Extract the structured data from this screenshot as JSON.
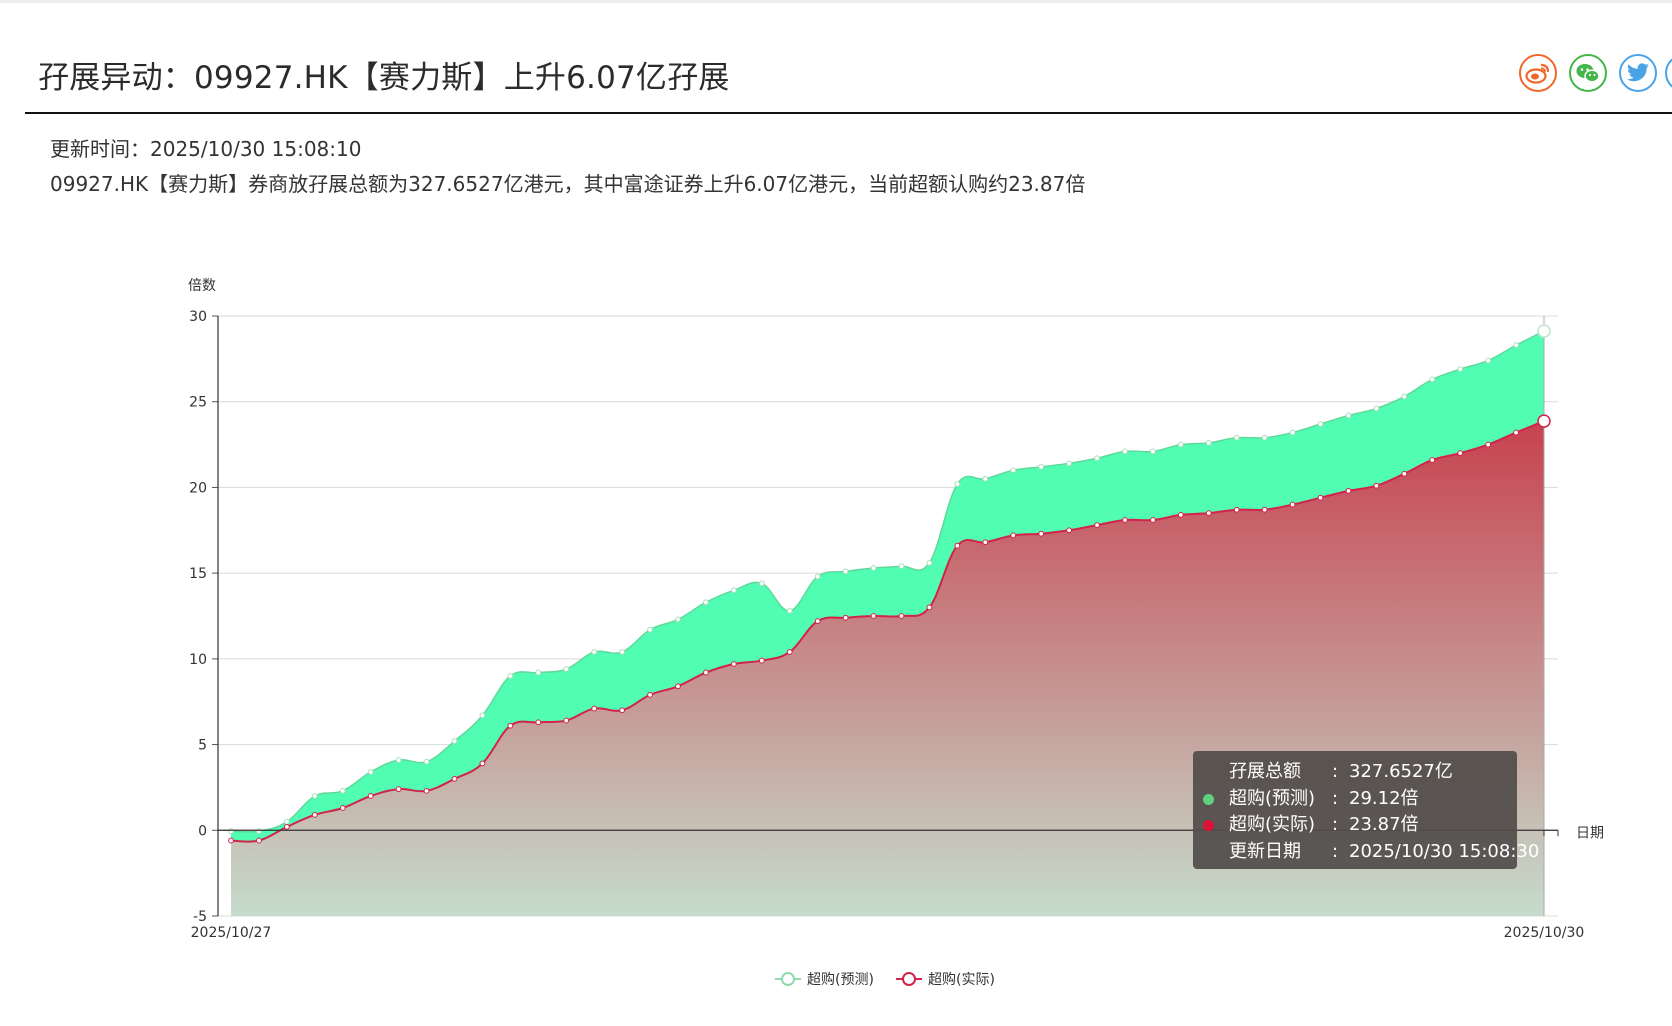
{
  "page": {
    "title": "孖展异动：09927.HK【赛力斯】上升6.07亿孖展",
    "update_time": "更新时间：2025/10/30 15:08:10",
    "summary": "09927.HK【赛力斯】券商放孖展总额为327.6527亿港元，其中富途证券上升6.07亿港元，当前超额认购约23.87倍"
  },
  "share": [
    {
      "name": "weibo-icon",
      "color": "#f0662b"
    },
    {
      "name": "wechat-icon",
      "color": "#44b549"
    },
    {
      "name": "twitter-icon",
      "color": "#4ba3e7"
    }
  ],
  "tooltip": {
    "rows": [
      {
        "label": "孖展总额",
        "value": "327.6527亿",
        "dot": ""
      },
      {
        "label": "超购(预测)",
        "value": "29.12倍",
        "dot": "#5fd17c"
      },
      {
        "label": "超购(实际)",
        "value": "23.87倍",
        "dot": "#dd1237"
      },
      {
        "label": "更新日期",
        "value": "2025/10/30 15:08:30",
        "dot": ""
      }
    ]
  },
  "chart_data": {
    "type": "area",
    "ylabel": "倍数",
    "xlabel": "日期",
    "ylim": [
      -5,
      30
    ],
    "yticks": [
      -5,
      0,
      5,
      10,
      15,
      20,
      25,
      30
    ],
    "x_tick_labels": [
      "2025/10/27",
      "2025/10/30"
    ],
    "grid": true,
    "legend_position": "bottom-center",
    "series": [
      {
        "name": "超购(预测)",
        "color": "#5fd99a",
        "fill": "#4cfdb1",
        "values": [
          -0.05,
          -0.05,
          0.5,
          2.0,
          2.3,
          3.4,
          4.1,
          4.0,
          5.2,
          6.7,
          9.0,
          9.2,
          9.4,
          10.4,
          10.4,
          11.7,
          12.3,
          13.3,
          14.0,
          14.4,
          12.8,
          14.8,
          15.1,
          15.3,
          15.4,
          15.6,
          20.2,
          20.5,
          21.0,
          21.2,
          21.4,
          21.7,
          22.1,
          22.1,
          22.5,
          22.6,
          22.9,
          22.9,
          23.2,
          23.7,
          24.2,
          24.6,
          25.3,
          26.3,
          26.9,
          27.4,
          28.3,
          29.12
        ]
      },
      {
        "name": "超购(实际)",
        "color": "#d2234a",
        "fill_top": "#c7424f",
        "fill_bottom": "#c6dccc",
        "values": [
          -0.6,
          -0.6,
          0.2,
          0.9,
          1.3,
          2.0,
          2.4,
          2.3,
          3.0,
          3.9,
          6.1,
          6.3,
          6.4,
          7.1,
          7.0,
          7.9,
          8.4,
          9.2,
          9.7,
          9.9,
          10.4,
          12.2,
          12.4,
          12.5,
          12.5,
          13.0,
          16.6,
          16.8,
          17.2,
          17.3,
          17.5,
          17.8,
          18.1,
          18.1,
          18.4,
          18.5,
          18.7,
          18.7,
          19.0,
          19.4,
          19.8,
          20.1,
          20.8,
          21.6,
          22.0,
          22.5,
          23.2,
          23.87
        ]
      }
    ]
  }
}
